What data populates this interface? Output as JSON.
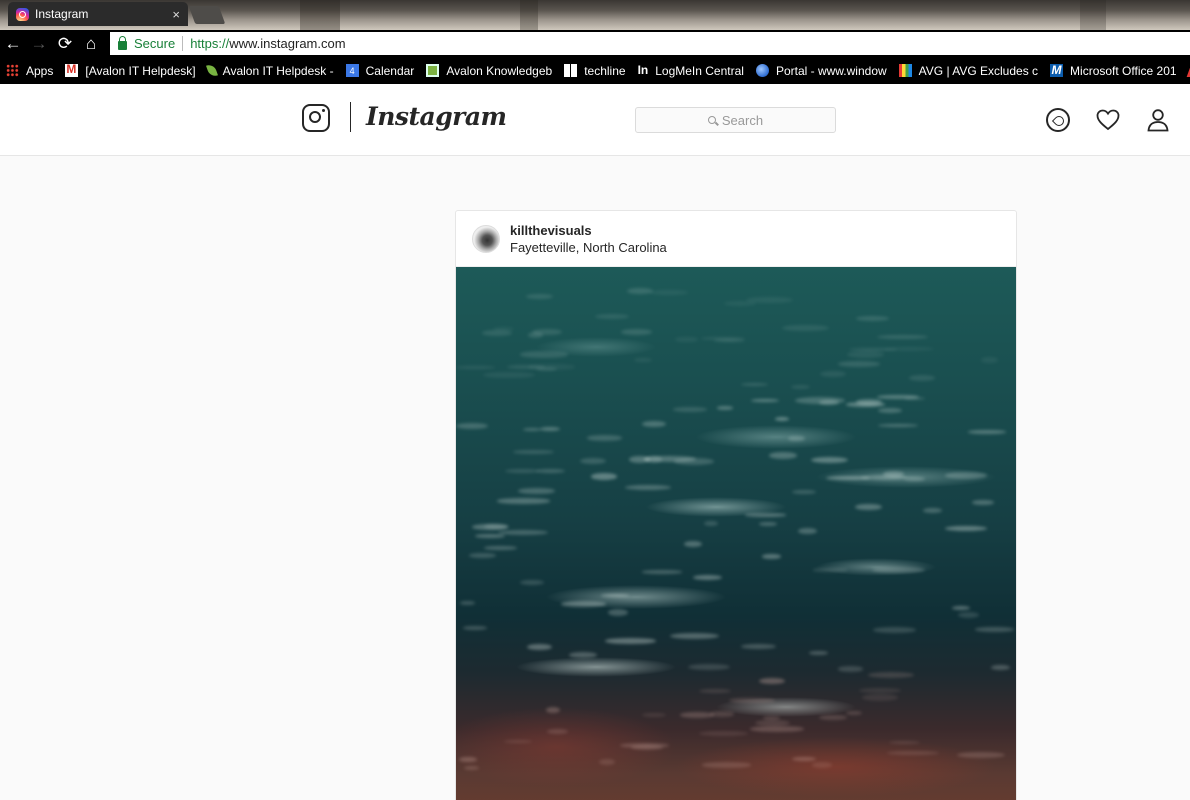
{
  "browser": {
    "tab": {
      "title": "Instagram",
      "close_glyph": "×"
    },
    "nav": {
      "back": "←",
      "forward": "→",
      "reload": "⟳",
      "home": "⌂"
    },
    "omnibox": {
      "secure_label": "Secure",
      "url_scheme": "https://",
      "url_host": "www.instagram.com"
    },
    "bookmarks": [
      {
        "icon": "apps",
        "label": "Apps"
      },
      {
        "icon": "gmail",
        "label": "[Avalon IT Helpdesk]"
      },
      {
        "icon": "leaf",
        "label": "Avalon IT Helpdesk -"
      },
      {
        "icon": "cal",
        "label": "Calendar"
      },
      {
        "icon": "kb",
        "label": "Avalon Knowledgeb"
      },
      {
        "icon": "win",
        "label": "techline"
      },
      {
        "icon": "lmi",
        "label": "LogMeIn Central"
      },
      {
        "icon": "globe",
        "label": "Portal - www.window"
      },
      {
        "icon": "avg",
        "label": "AVG | AVG Excludes c"
      },
      {
        "icon": "ms",
        "label": "Microsoft Office 201"
      }
    ],
    "calendar_day": "4",
    "lmi_glyph": "In",
    "ms_glyph": "M"
  },
  "instagram": {
    "wordmark": "Instagram",
    "search": {
      "placeholder": "Search"
    },
    "post": {
      "username": "killthevisuals",
      "location": "Fayetteville, North Carolina"
    }
  },
  "colors": {
    "chrome_bg": "#000000",
    "secure_green": "#188038",
    "ig_text": "#262626",
    "page_bg": "#fafafa"
  }
}
